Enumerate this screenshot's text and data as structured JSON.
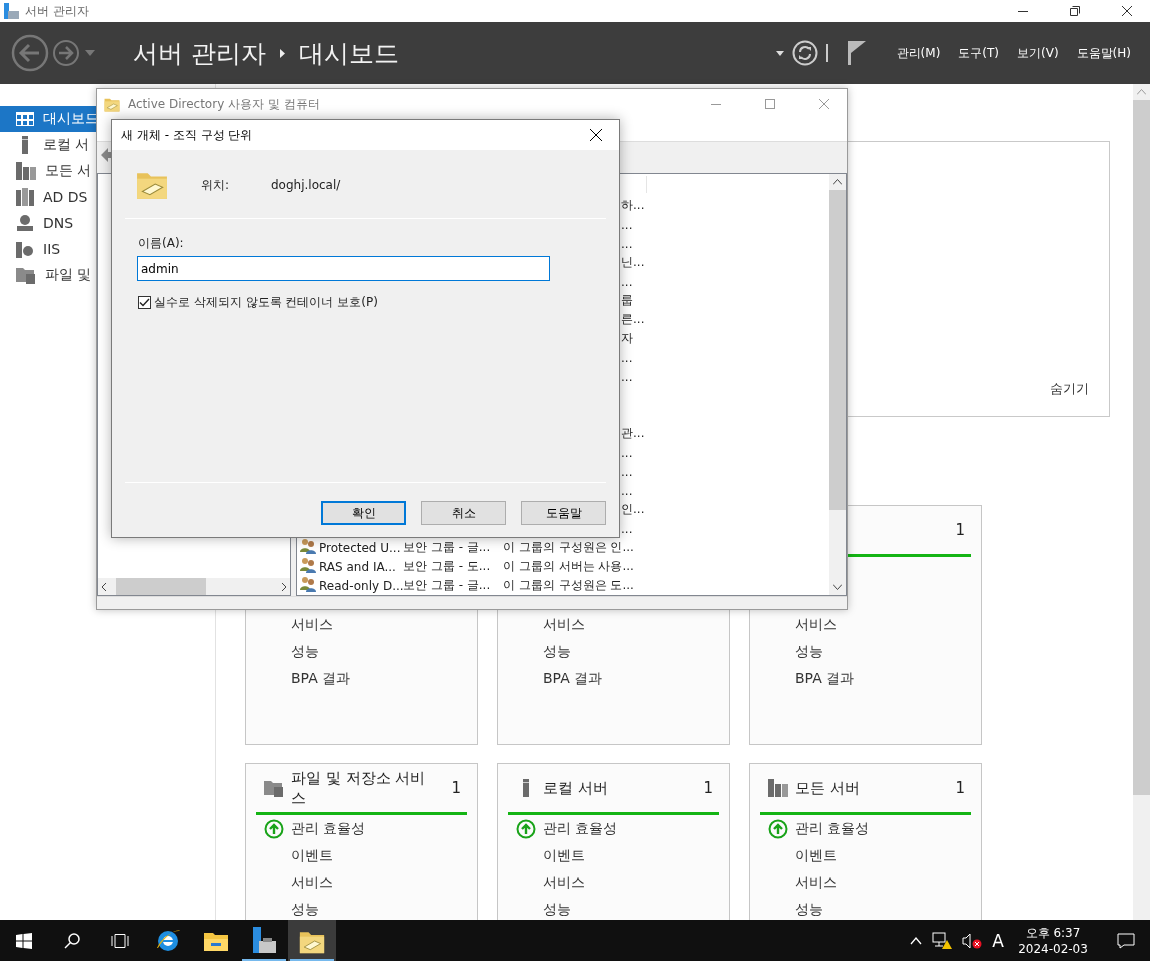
{
  "window": {
    "title": "서버 관리자"
  },
  "header": {
    "path": [
      "서버 관리자",
      "대시보드"
    ],
    "menus": [
      "관리(M)",
      "도구(T)",
      "보기(V)",
      "도움말(H)"
    ]
  },
  "sidebar": {
    "items": [
      {
        "label": "대시보드",
        "selected": true
      },
      {
        "label": "로컬 서",
        "selected": false
      },
      {
        "label": "모든 서",
        "selected": false
      },
      {
        "label": "AD DS",
        "selected": false
      },
      {
        "label": "DNS",
        "selected": false
      },
      {
        "label": "IIS",
        "selected": false
      },
      {
        "label": "파일 및",
        "selected": false
      }
    ]
  },
  "welcome": {
    "hide_link": "숨기기"
  },
  "tiles": [
    {
      "kind": "partial",
      "items": [
        {
          "kind": "covered"
        },
        {
          "kind": "covered"
        },
        {
          "kind": "plain",
          "label": "서비스"
        },
        {
          "kind": "plain",
          "label": "성능"
        },
        {
          "kind": "plain",
          "label": "BPA 결과"
        }
      ]
    },
    {
      "kind": "partial",
      "items": [
        {
          "kind": "covered"
        },
        {
          "kind": "covered"
        },
        {
          "kind": "plain",
          "label": "서비스"
        },
        {
          "kind": "plain",
          "label": "성능"
        },
        {
          "kind": "plain",
          "label": "BPA 결과"
        }
      ]
    },
    {
      "kind": "count",
      "count": "1",
      "items": [
        {
          "kind": "covered"
        },
        {
          "kind": "covered"
        },
        {
          "kind": "plain",
          "label": "서비스"
        },
        {
          "kind": "plain",
          "label": "성능"
        },
        {
          "kind": "plain",
          "label": "BPA 결과"
        }
      ]
    },
    {
      "kind": "full",
      "title": "파일 및 저장소 서비스",
      "count": "1",
      "items": [
        {
          "kind": "status",
          "label": "관리 효율성"
        },
        {
          "kind": "plain",
          "label": "이벤트"
        },
        {
          "kind": "plain",
          "label": "서비스"
        },
        {
          "kind": "plain",
          "label": "성능"
        }
      ]
    },
    {
      "kind": "full",
      "title": "로컬 서버",
      "count": "1",
      "items": [
        {
          "kind": "status",
          "label": "관리 효율성"
        },
        {
          "kind": "plain",
          "label": "이벤트"
        },
        {
          "kind": "plain",
          "label": "서비스"
        },
        {
          "kind": "plain",
          "label": "성능"
        }
      ]
    },
    {
      "kind": "full",
      "title": "모든 서버",
      "count": "1",
      "items": [
        {
          "kind": "status",
          "label": "관리 효율성"
        },
        {
          "kind": "plain",
          "label": "이벤트"
        },
        {
          "kind": "plain",
          "label": "서비스"
        },
        {
          "kind": "plain",
          "label": "성능"
        }
      ]
    }
  ],
  "ad_window": {
    "title": "Active Directory 사용자 및 컴퓨터",
    "rows": [
      {
        "kind": "fragment",
        "text": "하..."
      },
      {
        "kind": "fragment",
        "text": "..."
      },
      {
        "kind": "fragment",
        "text": "..."
      },
      {
        "kind": "fragment",
        "text": "닌..."
      },
      {
        "kind": "fragment",
        "text": "..."
      },
      {
        "kind": "fragment",
        "text": "룹"
      },
      {
        "kind": "fragment",
        "text": "른..."
      },
      {
        "kind": "fragment",
        "text": "자"
      },
      {
        "kind": "fragment",
        "text": "..."
      },
      {
        "kind": "fragment",
        "text": "..."
      },
      {
        "kind": "blank"
      },
      {
        "kind": "blank"
      },
      {
        "kind": "fragment",
        "text": "관..."
      },
      {
        "kind": "fragment",
        "text": "..."
      },
      {
        "kind": "fragment",
        "text": "..."
      },
      {
        "kind": "fragment",
        "text": "..."
      },
      {
        "kind": "fragment",
        "text": "인..."
      },
      {
        "kind": "fragment",
        "text": "..."
      },
      {
        "kind": "object",
        "name": "Protected U...",
        "type": "보안 그룹 - 글...",
        "description": "이 그룹의 구성원은 인..."
      },
      {
        "kind": "object",
        "name": "RAS and IA...",
        "type": "보안 그룹 - 도...",
        "description": "이 그룹의 서버는 사용..."
      },
      {
        "kind": "object",
        "name": "Read-only D...",
        "type": "보안 그룹 - 글...",
        "description": "이 그룹의 구성원은 도..."
      }
    ]
  },
  "dialog": {
    "title": "새 개체 - 조직 구성 단위",
    "location_label": "위치:",
    "location": "doghj.local/",
    "name_label": "이름(A):",
    "name_value": "admin",
    "protect": {
      "label": "실수로 삭제되지 않도록 컨테이너 보호(P)",
      "checked": true
    },
    "buttons": [
      {
        "label": "확인",
        "default": true
      },
      {
        "label": "취소",
        "default": false
      },
      {
        "label": "도움말",
        "default": false
      }
    ]
  },
  "taskbar": {
    "apps": [
      {
        "running": false,
        "selected": false
      },
      {
        "running": false,
        "selected": false
      },
      {
        "running": true,
        "selected": false
      },
      {
        "running": true,
        "selected": true
      }
    ],
    "ime": "A",
    "time": "오후 6:37",
    "date": "2024-02-03"
  }
}
